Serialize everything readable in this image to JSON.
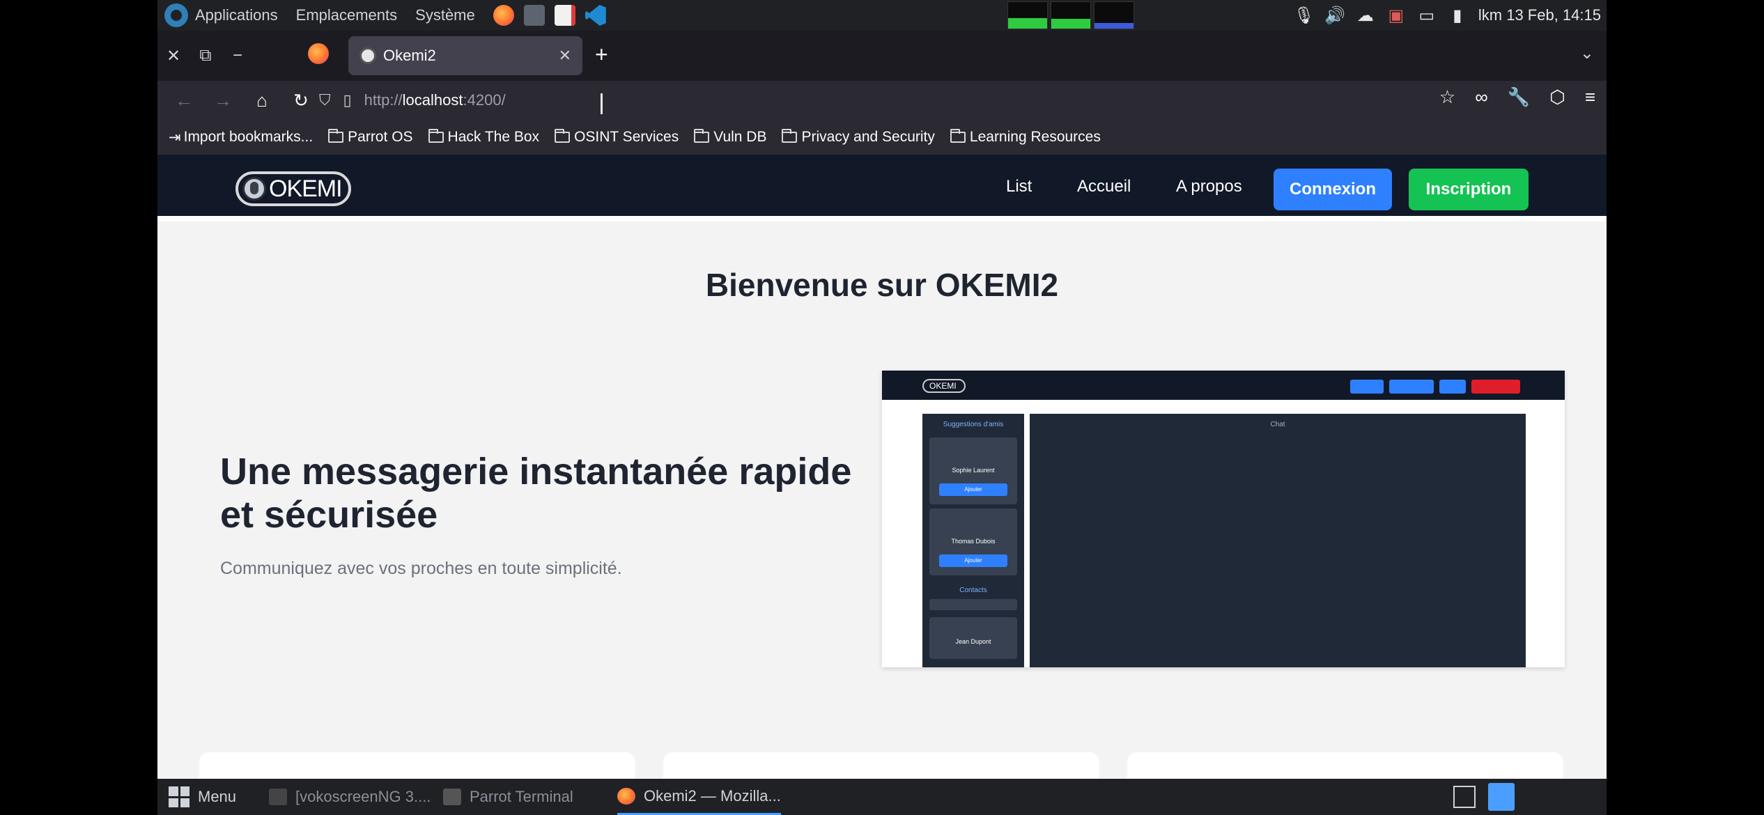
{
  "system_bar": {
    "menus": [
      "Applications",
      "Emplacements",
      "Système"
    ],
    "clock": "lkm 13 Feb, 14:15"
  },
  "browser": {
    "tab_title": "Okemi2",
    "url_prefix": "http://",
    "url_host": "localhost",
    "url_suffix": ":4200/",
    "bookmarks": [
      "Import bookmarks...",
      "Parrot OS",
      "Hack The Box",
      "OSINT Services",
      "Vuln DB",
      "Privacy and Security",
      "Learning Resources"
    ]
  },
  "site": {
    "logo_text": "OKEMI",
    "nav_links": [
      "List",
      "Accueil",
      "A propos"
    ],
    "btn_connexion": "Connexion",
    "btn_inscription": "Inscription",
    "welcome": "Bienvenue sur OKEMI2",
    "hero_title": "Une messagerie instantanée rapide et sécurisée",
    "hero_subtitle": "Communiquez avec vos proches en toute simplicité."
  },
  "preview": {
    "logo_text": "OKEMI",
    "side_title": "Suggestions d'amis",
    "card1_name": "Sophie Laurent",
    "card1_btn": "Ajouter",
    "card2_name": "Thomas Dubois",
    "card2_btn": "Ajouter",
    "contacts_title": "Contacts",
    "card3_name": "Jean Dupont",
    "chat_title": "Chat"
  },
  "taskbar": {
    "menu": "Menu",
    "items": [
      "[vokoscreenNG 3....",
      "Parrot Terminal",
      "Okemi2 — Mozilla..."
    ]
  },
  "colors": {
    "site_nav_bg": "#111827",
    "btn_connexion": "#2f80ff",
    "btn_inscription": "#15c254"
  }
}
